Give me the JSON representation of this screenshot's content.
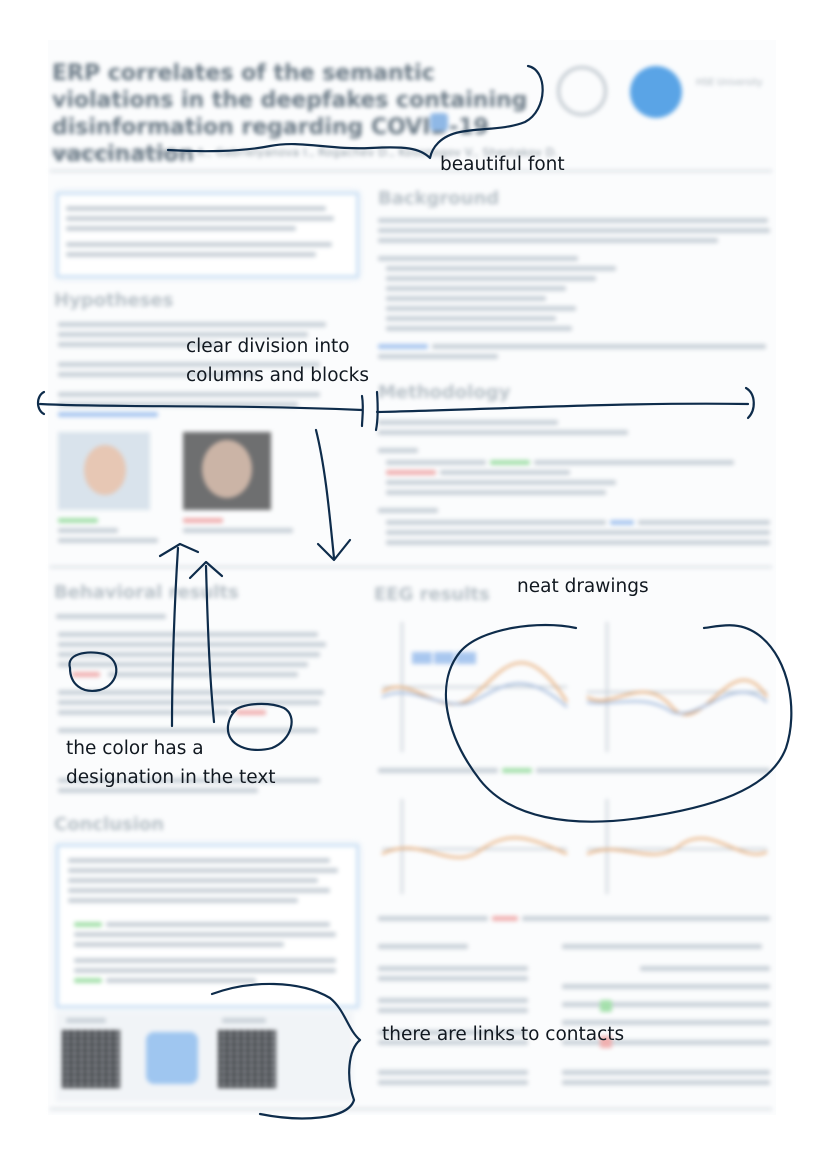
{
  "poster": {
    "title": "ERP correlates of the semantic violations in the deepfakes containing disinformation regarding COVID-19 vaccination",
    "authors": "Mazhitova E., Shestakov A., Gabrielyanova I., Rogachev D., Kosonogov V., Shestakov D.",
    "affiliation_text": "HSE University",
    "section_titles": {
      "hypotheses": "Hypotheses",
      "background": "Background",
      "methodology": "Methodology",
      "behavioral": "Behavioral results",
      "eeg": "EEG results",
      "conclusion": "Conclusion"
    }
  },
  "annotations": {
    "font": "beautiful font",
    "columns": "clear division into\ncolumns and blocks",
    "drawings": "neat drawings",
    "color": "the color has a\ndesignation in the text",
    "links": "there are links to contacts"
  },
  "colors": {
    "ink": "#0e2c4b",
    "accent_blue": "#5aa4e6",
    "positive": "#53c25f",
    "negative": "#e35b5b"
  }
}
